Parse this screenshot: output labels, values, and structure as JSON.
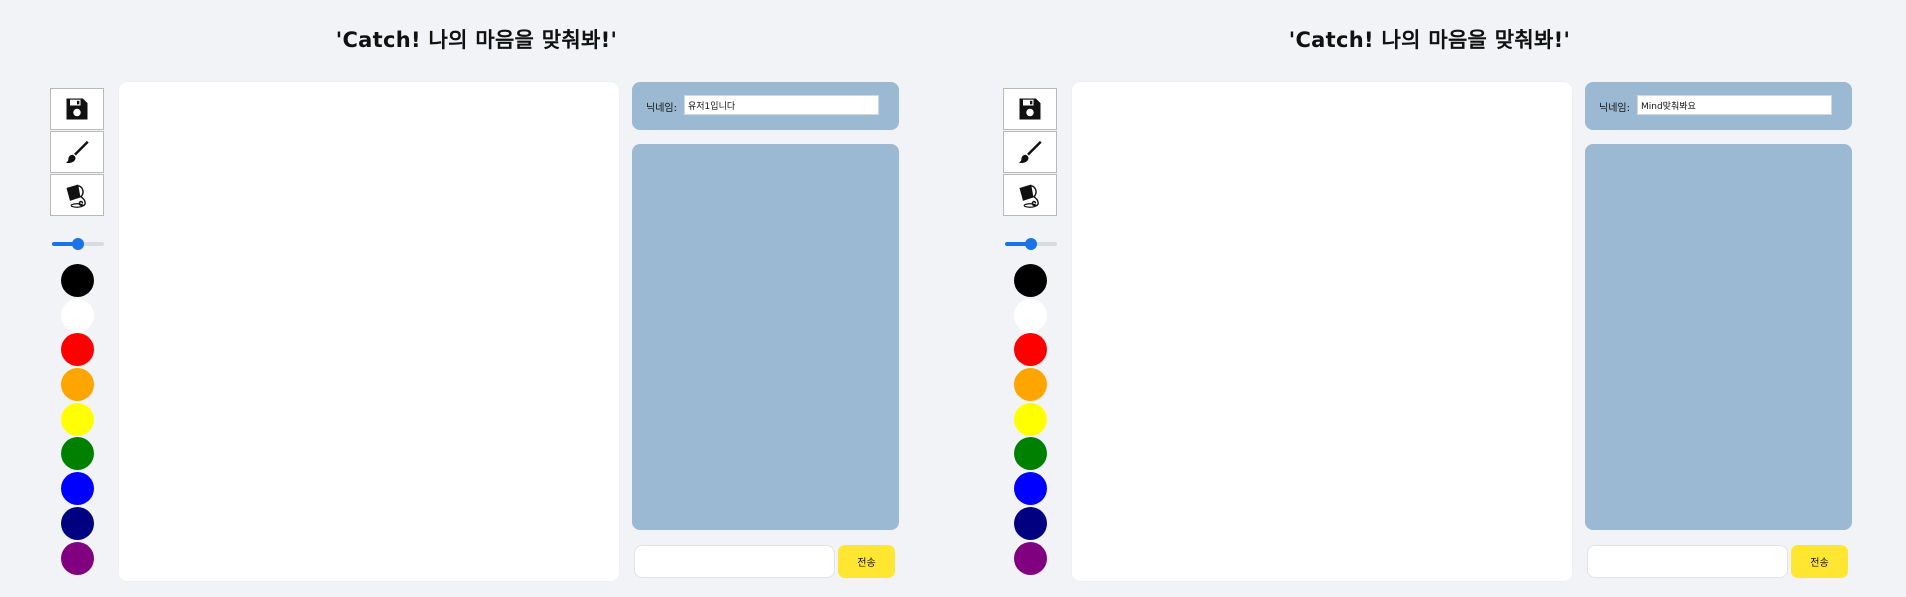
{
  "panes": [
    {
      "title": "'Catch! 나의 마음을 맞춰봐!'",
      "nickname_label": "닉네임:",
      "nickname_value": "유저1입니다",
      "send_label": "전송",
      "message_value": ""
    },
    {
      "title": "'Catch! 나의 마음을 맞춰봐!'",
      "nickname_label": "닉네임:",
      "nickname_value": "Mind맞춰봐요",
      "send_label": "전송",
      "message_value": ""
    }
  ],
  "tools": [
    "save-icon",
    "brush-icon",
    "paint-bucket-icon"
  ],
  "brush_size_fraction": 0.45,
  "palette": [
    "#000000",
    "#ffffff",
    "#ff0000",
    "#ffa500",
    "#ffff00",
    "#008000",
    "#0000ff",
    "#000080",
    "#800080"
  ],
  "colors": {
    "background": "#f2f3f7",
    "panel": "#9bb9d3",
    "send_button": "#ffe630",
    "slider_accent": "#1a73e8"
  }
}
